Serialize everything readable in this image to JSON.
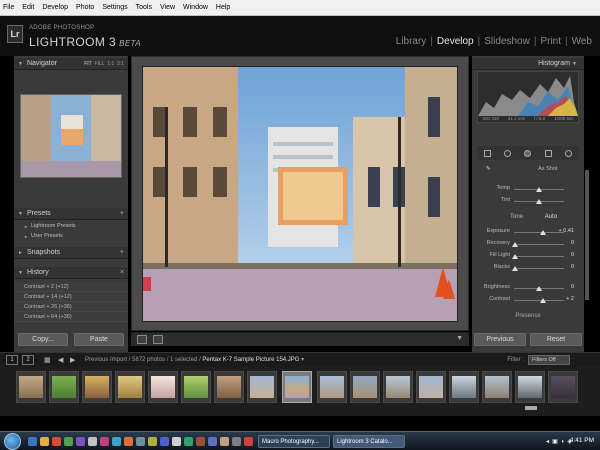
{
  "menubar": [
    "File",
    "Edit",
    "Develop",
    "Photo",
    "Settings",
    "Tools",
    "View",
    "Window",
    "Help"
  ],
  "header": {
    "logo_text": "Lr",
    "brand_small": "ADOBE PHOTOSHOP",
    "brand_big": "LIGHTROOM 3",
    "brand_beta": "BETA",
    "modules": [
      {
        "label": "Library",
        "active": false
      },
      {
        "label": "Develop",
        "active": true
      },
      {
        "label": "Slideshow",
        "active": false
      },
      {
        "label": "Print",
        "active": false
      },
      {
        "label": "Web",
        "active": false
      }
    ]
  },
  "left": {
    "navigator": {
      "title": "Navigator",
      "opt_fit": "FIT",
      "opt_fill": "FILL",
      "opt_11": "1:1",
      "opt_31": "3:1"
    },
    "presets": {
      "title": "Presets",
      "items": [
        "Lightroom Presets",
        "User Presets"
      ]
    },
    "snapshots": {
      "title": "Snapshots"
    },
    "history": {
      "title": "History",
      "items": [
        "Contrast + 2 (+12)",
        "Contrast + 14 (+12)",
        "Contrast + 26 (+38)",
        "Contrast + 64 (+38)"
      ]
    },
    "copy_label": "Copy...",
    "paste_label": "Paste"
  },
  "right": {
    "histogram": {
      "title": "Histogram",
      "iso": "ISO 320",
      "focal": "41.1 mm",
      "aperture": "f / 8.0",
      "shutter": "1/200 sec"
    },
    "as_shot": "As Shot",
    "sliders_top": [
      {
        "label": "Temp",
        "value": ""
      },
      {
        "label": "Tint",
        "value": ""
      }
    ],
    "tone_label": "Tone",
    "auto_label": "Auto",
    "sliders_tone": [
      {
        "label": "Exposure",
        "value": "+ 0.41"
      },
      {
        "label": "Recovery",
        "value": "0"
      },
      {
        "label": "Fill Light",
        "value": "0"
      },
      {
        "label": "Blacks",
        "value": "0"
      }
    ],
    "sliders_bc": [
      {
        "label": "Brightness",
        "value": "0"
      },
      {
        "label": "Contrast",
        "value": "+ 2"
      }
    ],
    "presence_label": "Presence",
    "previous_label": "Previous",
    "reset_label": "Reset"
  },
  "filmstrip": {
    "num1": "1",
    "num2": "2",
    "info_prefix": "Previous Import / 5872 photos / 1 selected /",
    "info_file": "Pentax K-7 Sample Picture 154.JPG",
    "filter_label": "Filter :",
    "filter_value": "Filters Off"
  },
  "taskbar": {
    "task1": "Macro Photography...",
    "task2": "Lightroom 3 Catalo...",
    "clock": "4:41 PM"
  }
}
